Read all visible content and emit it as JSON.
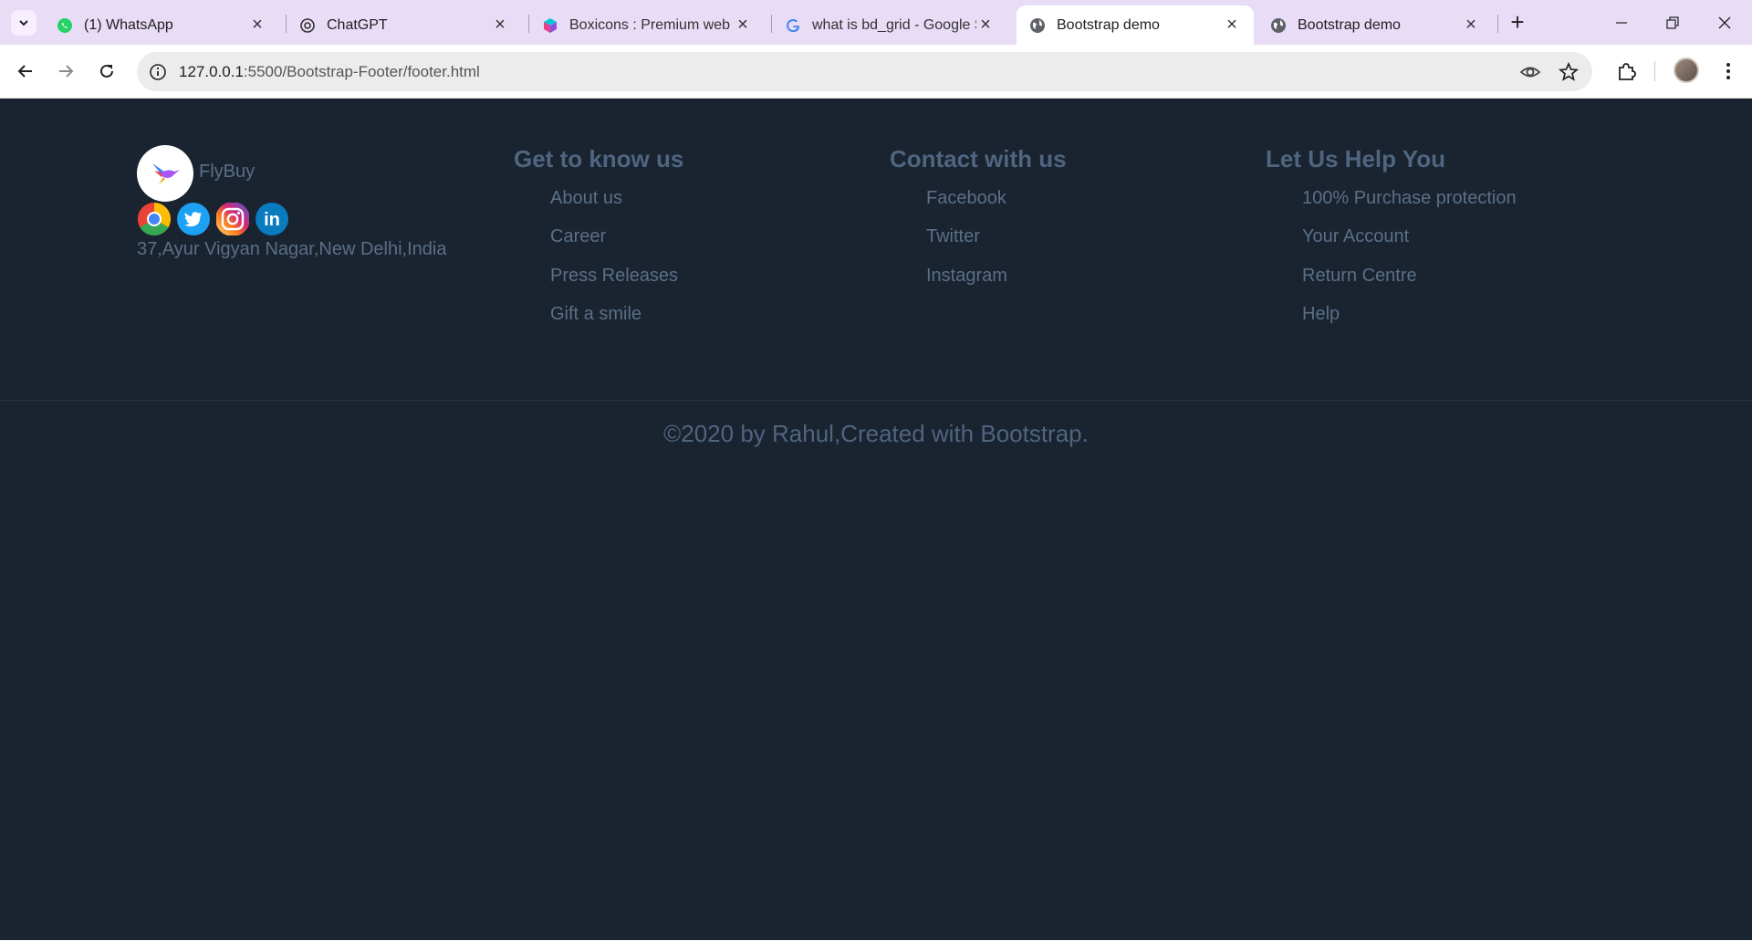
{
  "browser": {
    "tabs": [
      {
        "title": "(1) WhatsApp",
        "favicon": "whatsapp-icon"
      },
      {
        "title": "ChatGPT",
        "favicon": "chatgpt-icon"
      },
      {
        "title": "Boxicons : Premium web fr",
        "favicon": "boxicons-icon"
      },
      {
        "title": "what is bd_grid - Google S",
        "favicon": "google-icon"
      },
      {
        "title": "Bootstrap demo",
        "favicon": "globe-icon",
        "active": true
      },
      {
        "title": "Bootstrap demo",
        "favicon": "globe-icon"
      }
    ],
    "url_host": "127.0.0.1",
    "url_path": ":5500/Bootstrap-Footer/footer.html"
  },
  "footer": {
    "brand": "FlyBuy",
    "address": "37,Ayur Vigyan Nagar,New Delhi,India",
    "social": [
      "chrome-icon",
      "twitter-icon",
      "instagram-icon",
      "linkedin-icon"
    ],
    "columns": [
      {
        "heading": "Get to know us",
        "links": [
          "About us",
          "Career",
          "Press Releases",
          "Gift a smile"
        ]
      },
      {
        "heading": "Contact with us",
        "links": [
          "Facebook",
          "Twitter",
          "Instagram"
        ]
      },
      {
        "heading": "Let Us Help You",
        "links": [
          "100% Purchase protection",
          "Your Account",
          "Return Centre",
          "Help"
        ]
      }
    ],
    "copyright": "©2020 by Rahul,Created with Bootstrap."
  },
  "colors": {
    "background": "#1a2330",
    "heading": "#4f6580",
    "link": "#5a7088",
    "tabstrip": "#e8dcf7"
  }
}
